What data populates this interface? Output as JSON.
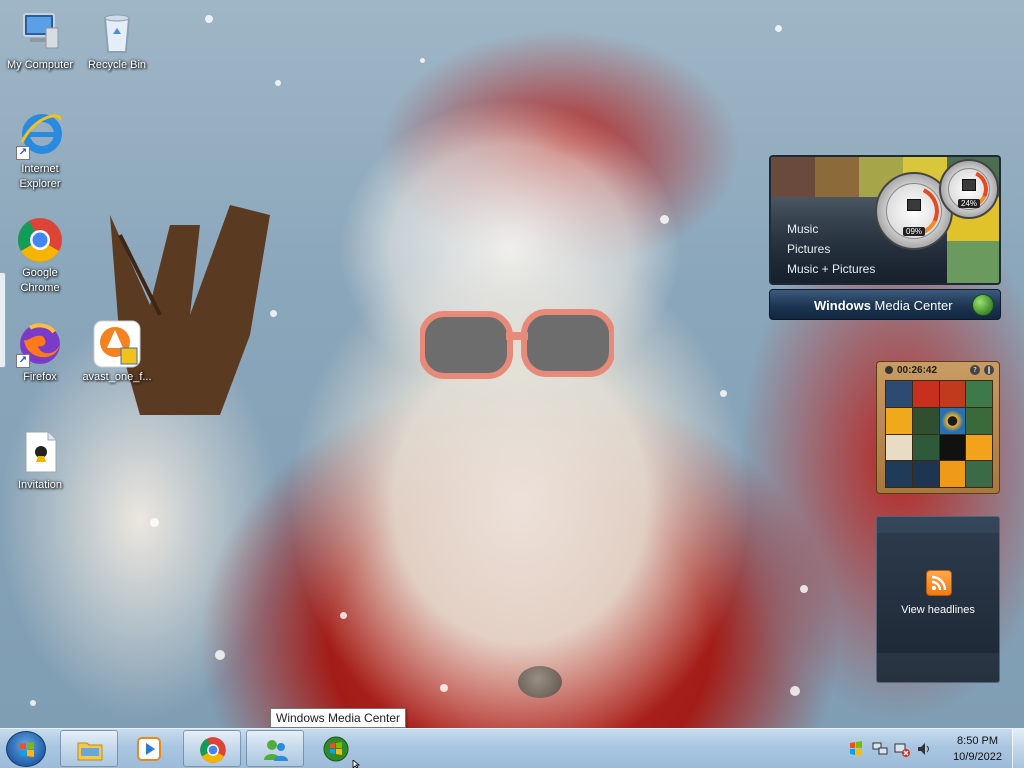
{
  "desktop": {
    "icons": [
      {
        "label": "My Computer",
        "icon": "computer-icon"
      },
      {
        "label": "Recycle Bin",
        "icon": "recycle-bin-icon"
      },
      {
        "label": "Internet Explorer",
        "icon": "internet-explorer-icon"
      },
      {
        "label": "Google Chrome",
        "icon": "chrome-icon"
      },
      {
        "label": "Firefox",
        "icon": "firefox-icon"
      },
      {
        "label": "avast_one_f...",
        "icon": "avast-installer-icon"
      },
      {
        "label": "Invitation",
        "icon": "document-icon"
      }
    ]
  },
  "gadgets": {
    "media_center": {
      "menu": [
        "Music",
        "Pictures",
        "Music + Pictures"
      ],
      "title_bold": "Windows",
      "title_rest": " Media Center"
    },
    "cpu_meter": {
      "cpu": "09%",
      "memory": "24%"
    },
    "puzzle": {
      "timer": "00:26:42"
    },
    "rss": {
      "label": "View headlines"
    }
  },
  "tooltip": {
    "text": "Windows Media Center"
  },
  "taskbar": {
    "items": [
      {
        "name": "windows-explorer",
        "icon": "folder-icon"
      },
      {
        "name": "windows-media-player",
        "icon": "media-player-icon"
      },
      {
        "name": "google-chrome",
        "icon": "chrome-icon"
      },
      {
        "name": "windows-live-messenger",
        "icon": "messenger-icon"
      },
      {
        "name": "windows-media-center",
        "icon": "media-center-icon"
      }
    ],
    "clock": {
      "time": "8:50 PM",
      "date": "10/9/2022"
    }
  }
}
